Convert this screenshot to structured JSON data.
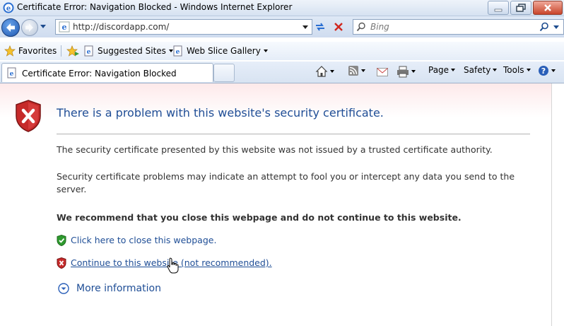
{
  "window": {
    "title": "Certificate Error: Navigation Blocked - Windows Internet Explorer"
  },
  "address_bar": {
    "url": "http://discordapp.com/",
    "search_placeholder": "Bing"
  },
  "favorites_bar": {
    "favorites_label": "Favorites",
    "suggested_sites_label": "Suggested Sites",
    "web_slice_gallery_label": "Web Slice Gallery"
  },
  "tabs": [
    {
      "label": "Certificate Error: Navigation Blocked"
    }
  ],
  "command_bar": {
    "page_label": "Page",
    "safety_label": "Safety",
    "tools_label": "Tools"
  },
  "page": {
    "heading": "There is a problem with this website's security certificate.",
    "para1": "The security certificate presented by this website was not issued by a trusted certificate authority.",
    "para2": "Security certificate problems may indicate an attempt to fool you or intercept any data you send to the server.",
    "recommendation": "We recommend that you close this webpage and do not continue to this website.",
    "close_link": "Click here to close this webpage.",
    "continue_link": "Continue to this website (not recommended).",
    "more_info": "More information"
  },
  "colors": {
    "link": "#1f4e96",
    "danger": "#c62a2a",
    "safe": "#2f9a2f"
  }
}
